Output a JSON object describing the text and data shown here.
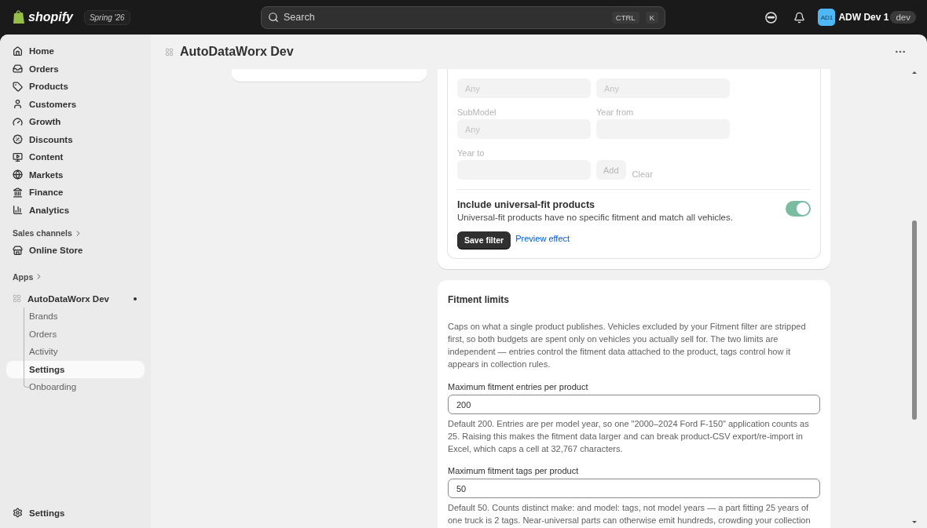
{
  "topbar": {
    "logo": "shopify",
    "edition": "Spring '26",
    "search": {
      "placeholder": "Search",
      "shortcut": [
        "CTRL",
        "K"
      ]
    },
    "avatar": "AD1",
    "user": "ADW Dev 1",
    "badge": "dev"
  },
  "sidebar": {
    "main_nav": [
      {
        "label": "Home"
      },
      {
        "label": "Orders"
      },
      {
        "label": "Products"
      },
      {
        "label": "Customers"
      },
      {
        "label": "Growth"
      },
      {
        "label": "Discounts"
      },
      {
        "label": "Content"
      },
      {
        "label": "Markets"
      },
      {
        "label": "Finance"
      },
      {
        "label": "Analytics"
      }
    ],
    "sales_channels": {
      "title": "Sales channels",
      "items": [
        {
          "label": "Online Store"
        }
      ]
    },
    "apps": {
      "title": "Apps",
      "app": {
        "label": "AutoDataWorx Dev",
        "children": [
          {
            "label": "Brands",
            "selected": false
          },
          {
            "label": "Orders",
            "selected": false
          },
          {
            "label": "Activity",
            "selected": false
          },
          {
            "label": "Settings",
            "selected": true
          },
          {
            "label": "Onboarding",
            "selected": false
          }
        ]
      }
    },
    "footer": {
      "label": "Settings"
    }
  },
  "page": {
    "title": "AutoDataWorx Dev",
    "filter_card": {
      "fields": [
        {
          "placeholder": "Any",
          "disabled": true
        },
        {
          "placeholder": "Any",
          "disabled": true
        },
        {
          "label": "SubModel",
          "placeholder": "Any",
          "disabled": true
        },
        {
          "label": "Year from",
          "disabled": true
        },
        {
          "label": "Year to",
          "disabled": true
        }
      ],
      "add_button": {
        "label": "Add",
        "disabled": true
      },
      "clear_link": {
        "label": "Clear",
        "disabled": true
      },
      "toggle": {
        "title": "Include universal-fit products",
        "description": "Universal-fit products have no specific fitment and match all vehicles.",
        "on": true
      },
      "save_button": "Save filter",
      "preview_link": "Preview effect"
    },
    "limits_card": {
      "title": "Fitment limits",
      "intro": "Caps on what a single product publishes. Vehicles excluded by your Fitment filter are stripped first, so both budgets are spent only on vehicles you actually sell for. The two limits are independent — entries control the fitment data attached to the product, tags control how it appears in collection rules.",
      "fields": [
        {
          "label": "Maximum fitment entries per product",
          "value": "200",
          "help": "Default 200. Entries are per model year, so one \"2000–2024 Ford F-150\" application counts as 25. Raising this makes the fitment data larger and can break product-CSV export/re-import in Excel, which caps a cell at 32,767 characters."
        },
        {
          "label": "Maximum fitment tags per product",
          "value": "50",
          "help": "Default 50. Counts distinct make: and model: tags, not model years — a part fitting 25 years of one truck is 2 tags. Near-universal parts can otherwise emit hundreds, crowding your collection"
        }
      ]
    }
  }
}
